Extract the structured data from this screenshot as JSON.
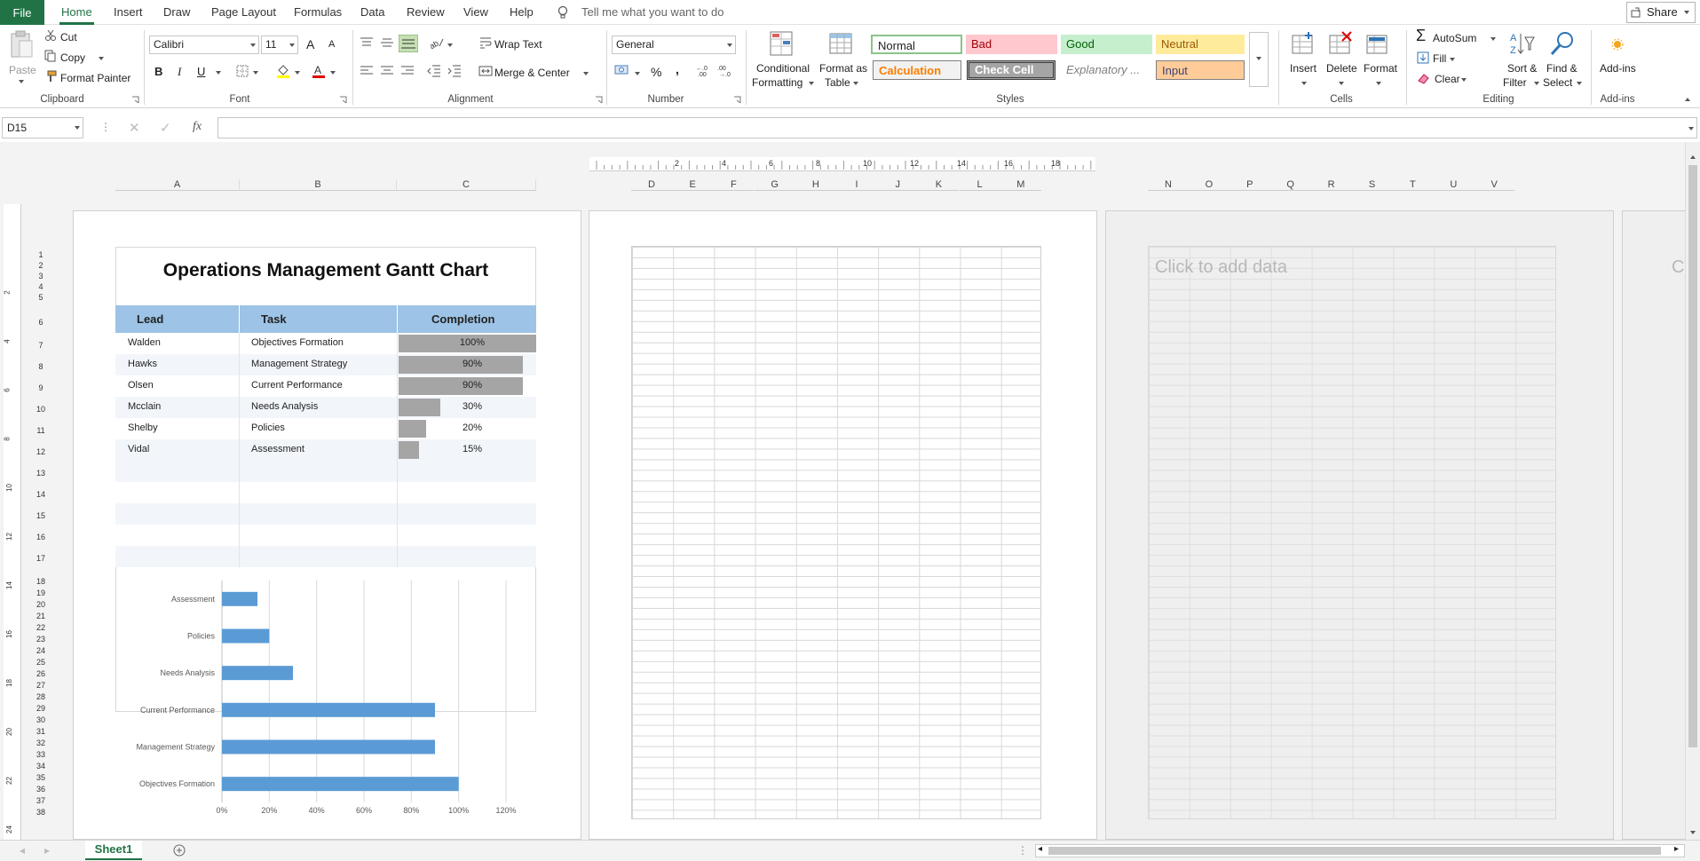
{
  "ribbon_tabs": [
    "File",
    "Home",
    "Insert",
    "Draw",
    "Page Layout",
    "Formulas",
    "Data",
    "Review",
    "View",
    "Help"
  ],
  "active_tab": "Home",
  "tell_me": "Tell me what you want to do",
  "share": "Share",
  "clipboard": {
    "paste": "Paste",
    "cut": "Cut",
    "copy": "Copy",
    "format_painter": "Format Painter",
    "group": "Clipboard"
  },
  "font": {
    "name": "Calibri",
    "size": "11",
    "group": "Font",
    "bold": "B",
    "italic": "I",
    "underline": "U",
    "grow": "A",
    "shrink": "A"
  },
  "alignment": {
    "wrap": "Wrap Text",
    "merge": "Merge & Center",
    "group": "Alignment"
  },
  "number": {
    "format": "General",
    "percent": "%",
    "comma": ",",
    "group": "Number"
  },
  "styles": {
    "conditional": "Conditional",
    "conditional2": "Formatting",
    "format_table": "Format as",
    "format_table2": "Table",
    "normal": "Normal",
    "bad": "Bad",
    "good": "Good",
    "neutral": "Neutral",
    "calculation": "Calculation",
    "check_cell": "Check Cell",
    "explanatory": "Explanatory ...",
    "input": "Input",
    "group": "Styles"
  },
  "cells": {
    "insert": "Insert",
    "delete": "Delete",
    "format": "Format",
    "group": "Cells"
  },
  "editing": {
    "autosum": "AutoSum",
    "fill": "Fill",
    "clear": "Clear",
    "sort": "Sort &",
    "sort2": "Filter",
    "find": "Find &",
    "find2": "Select",
    "group": "Editing"
  },
  "addins": {
    "label": "Add-ins",
    "group": "Add-ins"
  },
  "formula_bar": {
    "name_box": "D15",
    "fx": "fx",
    "content": ""
  },
  "ruler_ticks": [
    "2",
    "4",
    "6",
    "8",
    "10",
    "12",
    "14",
    "16",
    "18"
  ],
  "left_ruler_ticks": [
    "2",
    "4",
    "6",
    "8",
    "10",
    "12",
    "14",
    "16",
    "18",
    "20",
    "22",
    "24"
  ],
  "columns_page1": [
    "A",
    "B",
    "C"
  ],
  "columns_page2": [
    "D",
    "E",
    "F",
    "G",
    "H",
    "I",
    "J",
    "K",
    "L",
    "M"
  ],
  "columns_page3": [
    "N",
    "O",
    "P",
    "Q",
    "R",
    "S",
    "T",
    "U",
    "V"
  ],
  "rows": [
    "1",
    "2",
    "3",
    "4",
    "5",
    "6",
    "7",
    "8",
    "9",
    "10",
    "11",
    "12",
    "13",
    "14",
    "15",
    "16",
    "17",
    "18",
    "19",
    "20",
    "21",
    "22",
    "23",
    "24",
    "25",
    "26",
    "27",
    "28",
    "29",
    "30",
    "31",
    "32",
    "33",
    "34",
    "35",
    "36",
    "37",
    "38"
  ],
  "table": {
    "title": "Operations Management Gantt Chart",
    "headers": [
      "Lead",
      "Task",
      "Completion"
    ],
    "rows": [
      {
        "lead": "Walden",
        "task": "Objectives Formation",
        "completion": "100%",
        "fraction": 1.0
      },
      {
        "lead": "Hawks",
        "task": "Management Strategy",
        "completion": "90%",
        "fraction": 0.9
      },
      {
        "lead": "Olsen",
        "task": "Current Performance",
        "completion": "90%",
        "fraction": 0.9
      },
      {
        "lead": "Mcclain",
        "task": "Needs Analysis",
        "completion": "30%",
        "fraction": 0.3
      },
      {
        "lead": "Shelby",
        "task": "Policies",
        "completion": "20%",
        "fraction": 0.2
      },
      {
        "lead": "Vidal",
        "task": "Assessment",
        "completion": "15%",
        "fraction": 0.15
      }
    ]
  },
  "chart_data": {
    "type": "bar",
    "orientation": "horizontal",
    "categories": [
      "Objectives Formation",
      "Management Strategy",
      "Current Performance",
      "Needs Analysis",
      "Policies",
      "Assessment"
    ],
    "values": [
      100,
      90,
      90,
      30,
      20,
      15
    ],
    "xlim": [
      0,
      120
    ],
    "x_ticks": [
      "0%",
      "20%",
      "40%",
      "60%",
      "80%",
      "100%",
      "120%"
    ],
    "grid": true,
    "bar_color": "#5b9bd5"
  },
  "placeholder": "Click to add data",
  "sheet_tab": "Sheet1",
  "colors": {
    "accent": "#217346",
    "header_fill": "#9dc3e6",
    "bar_gray": "#a5a5a5"
  }
}
